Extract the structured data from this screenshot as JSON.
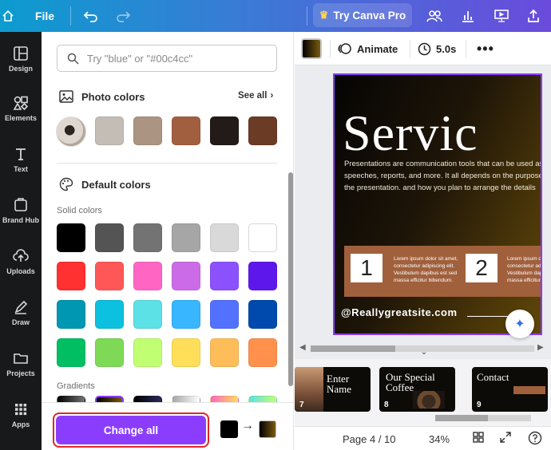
{
  "topbar": {
    "file_label": "File",
    "try_pro_label": "Try Canva Pro"
  },
  "sidebar": {
    "items": [
      {
        "label": "Design",
        "icon": "design-icon"
      },
      {
        "label": "Elements",
        "icon": "elements-icon"
      },
      {
        "label": "Text",
        "icon": "text-icon"
      },
      {
        "label": "Brand Hub",
        "icon": "brand-hub-icon"
      },
      {
        "label": "Uploads",
        "icon": "uploads-icon"
      },
      {
        "label": "Draw",
        "icon": "draw-icon"
      },
      {
        "label": "Projects",
        "icon": "projects-icon"
      },
      {
        "label": "Apps",
        "icon": "apps-icon"
      }
    ]
  },
  "panel": {
    "search_placeholder": "Try \"blue\" or \"#00c4cc\"",
    "photo_colors_title": "Photo colors",
    "see_all": "See all",
    "photo_colors": [
      "#c3bdb6",
      "#ab9481",
      "#a25f40",
      "#231b17",
      "#6b3b26"
    ],
    "default_colors_title": "Default colors",
    "solid_colors_label": "Solid colors",
    "solid_colors": [
      [
        "#000000",
        "#545454",
        "#737373",
        "#a6a6a6",
        "#d9d9d9",
        "#ffffff"
      ],
      [
        "#ff3131",
        "#ff5757",
        "#ff66c4",
        "#cb6ce6",
        "#8c52ff",
        "#5e17eb"
      ],
      [
        "#0097b2",
        "#0cc0df",
        "#5ce1e6",
        "#38b6ff",
        "#5271ff",
        "#004aad"
      ],
      [
        "#00bf63",
        "#7ed957",
        "#c1ff72",
        "#ffde59",
        "#ffbd59",
        "#ff914d"
      ]
    ],
    "gradients_label": "Gradients",
    "change_all_label": "Change all"
  },
  "editor": {
    "animate_label": "Animate",
    "duration_label": "5.0s",
    "slide": {
      "title": "Servic",
      "body": "Presentations are communication tools that can be used as speeches, reports, and more. It all depends on the purpose of the presentation. and how you plan to arrange the details",
      "num1": "1",
      "num2": "2",
      "band_text": "Lorem ipsum dolor sit amet, consectetur adipiscing elit. Vestibulum dapibus est sed massa efficitur bibendum.",
      "site": "@Reallygreatsite.com"
    },
    "thumbnails": [
      {
        "num": "7",
        "title": "Enter\nName"
      },
      {
        "num": "8",
        "title": "Our Special\nCoffee"
      },
      {
        "num": "9",
        "title": "Contact"
      }
    ],
    "page_label": "Page 4 / 10",
    "zoom_label": "34%"
  }
}
